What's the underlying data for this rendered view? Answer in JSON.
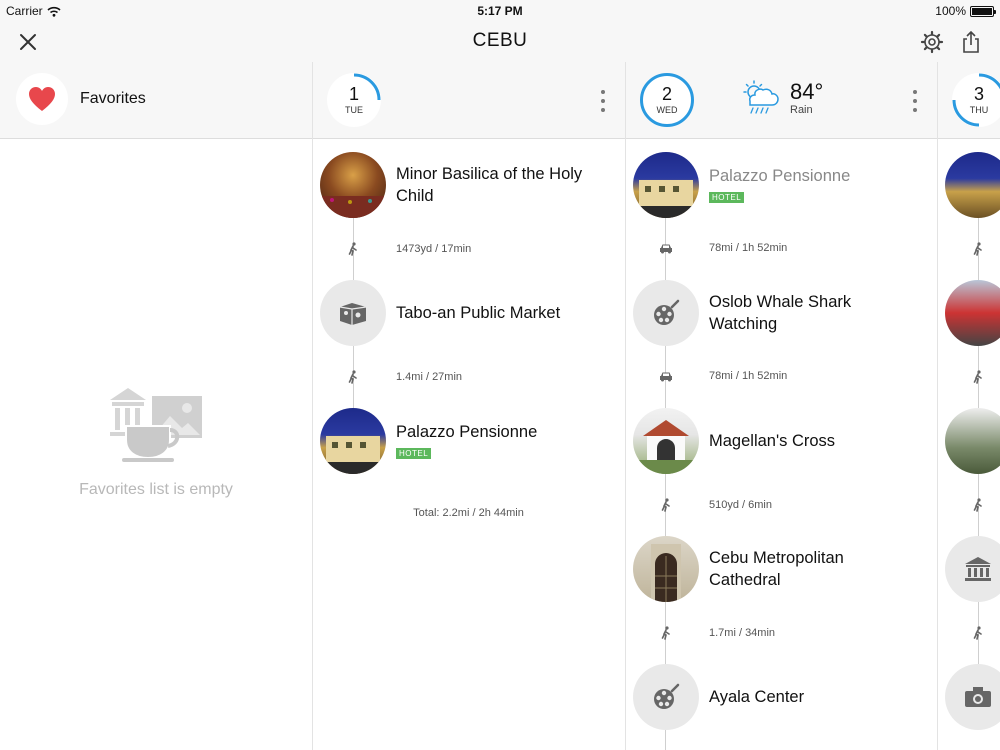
{
  "status_bar": {
    "carrier": "Carrier",
    "time": "5:17 PM",
    "battery": "100%"
  },
  "nav": {
    "title": "CEBU",
    "close_icon": "close-icon",
    "settings_icon": "gear-icon",
    "share_icon": "share-icon"
  },
  "favorites": {
    "label": "Favorites",
    "empty_text": "Favorites list is empty",
    "icon": "heart-icon"
  },
  "days": [
    {
      "number": "1",
      "weekday": "TUE"
    },
    {
      "number": "2",
      "weekday": "WED"
    },
    {
      "number": "3",
      "weekday": "THU"
    }
  ],
  "weather": {
    "temp": "84°",
    "condition": "Rain",
    "icon": "rain-cloud-icon"
  },
  "day1": {
    "stops": [
      {
        "name": "Minor Basilica of the Holy Child"
      },
      {
        "name": "Tabo-an Public Market"
      },
      {
        "name": "Palazzo Pensionne",
        "badge": "HOTEL"
      }
    ],
    "legs": [
      "1473yd / 17min",
      "1.4mi / 27min"
    ],
    "total": "Total: 2.2mi / 2h 44min"
  },
  "day2": {
    "stops": [
      {
        "name": "Palazzo Pensionne",
        "badge": "HOTEL"
      },
      {
        "name": "Oslob Whale Shark Watching"
      },
      {
        "name": "Magellan's Cross"
      },
      {
        "name": "Cebu Metropolitan Cathedral"
      },
      {
        "name": "Ayala Center"
      }
    ],
    "legs": [
      "78mi / 1h 52min",
      "78mi / 1h 52min",
      "510yd / 6min",
      "1.7mi / 34min"
    ]
  },
  "colors": {
    "accent": "#2a9ae0",
    "heart": "#e8474c",
    "hotel_badge": "#5cb85c",
    "header_bg": "#f7f7f7"
  }
}
